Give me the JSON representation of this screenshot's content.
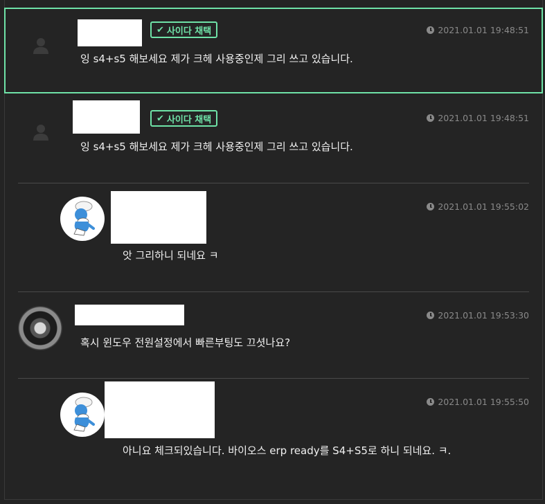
{
  "badge_label": "사이다 채택",
  "comments": [
    {
      "time": "2021.01.01 19:48:51",
      "text": "잉 s4+s5  해보세요  제가 크헤 사용중인제 그리 쓰고 있습니다.",
      "accepted": true,
      "avatar": "default-user-icon"
    },
    {
      "time": "2021.01.01 19:48:51",
      "text": "잉 s4+s5  해보세요  제가 크헤 사용중인제 그리 쓰고 있습니다.",
      "accepted": true,
      "avatar": "default-user-icon"
    },
    {
      "time": "2021.01.01 19:55:02",
      "text": "앗 그리하니 되네요 ㅋ",
      "accepted": false,
      "avatar": "smurf-avatar"
    },
    {
      "time": "2021.01.01 19:53:30",
      "text": "혹시 윈도우 전원설정에서 빠른부팅도 끄셧나요?",
      "accepted": false,
      "avatar": "dark-emblem-avatar"
    },
    {
      "time": "2021.01.01 19:55:50",
      "text": "아니요  체크되있습니다. 바이오스 erp ready를  S4+S5로  하니 되네요. ㅋ.",
      "accepted": false,
      "avatar": "smurf-avatar"
    }
  ],
  "colors": {
    "background": "#242424",
    "accent": "#6fe3a8",
    "muted": "#8a8a8a"
  }
}
